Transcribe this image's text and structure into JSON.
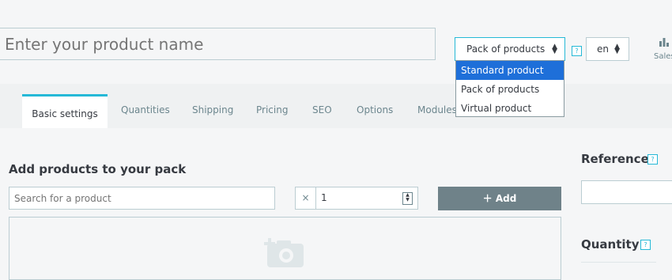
{
  "header": {
    "product_name_placeholder": "Enter your product name",
    "product_type": {
      "selected": "Pack of products",
      "options": [
        "Standard product",
        "Pack of products",
        "Virtual product"
      ],
      "highlighted": "Standard product"
    },
    "help_mark": "?",
    "language": "en",
    "sales_label": "Sales"
  },
  "tabs": [
    {
      "label": "Basic settings",
      "active": true
    },
    {
      "label": "Quantities"
    },
    {
      "label": "Shipping"
    },
    {
      "label": "Pricing"
    },
    {
      "label": "SEO"
    },
    {
      "label": "Options"
    },
    {
      "label": "Modules"
    }
  ],
  "pack": {
    "title": "Add products to your pack",
    "search_placeholder": "Search for a product",
    "quantity_prefix": "×",
    "quantity_value": "1",
    "add_button": "Add"
  },
  "right": {
    "reference_label": "Reference",
    "quantity_label": "Quantity"
  },
  "colors": {
    "accent": "#25b9d7",
    "button": "#6f8289",
    "dropdown_highlight": "#1e6fd9"
  }
}
